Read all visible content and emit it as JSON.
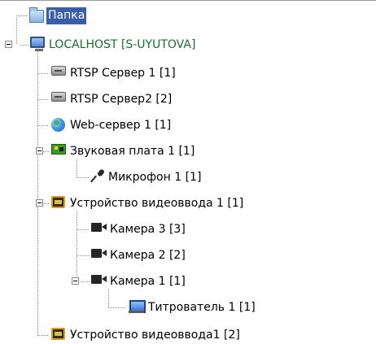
{
  "tree": {
    "folder": {
      "label": "Папка",
      "icon": "folder-icon"
    },
    "host": {
      "label": "LOCALHOST [S-UYUTOVA]",
      "icon": "monitor-icon",
      "color": "#16702a"
    },
    "rtsp1": {
      "label": "RTSP Сервер 1 [1]",
      "icon": "server-icon"
    },
    "rtsp2": {
      "label": "RTSP Сервер2 [2]",
      "icon": "server-icon"
    },
    "web": {
      "label": "Web-сервер 1 [1]",
      "icon": "globe-icon"
    },
    "sound": {
      "label": "Звуковая плата 1 [1]",
      "icon": "sound-card-icon"
    },
    "mic": {
      "label": "Микрофон 1 [1]",
      "icon": "microphone-icon"
    },
    "video1": {
      "label": "Устройство видеоввода 1 [1]",
      "icon": "chip-icon"
    },
    "cam3": {
      "label": "Камера 3 [3]",
      "icon": "camera-icon"
    },
    "cam2": {
      "label": "Камера 2 [2]",
      "icon": "camera-icon"
    },
    "cam1": {
      "label": "Камера 1 [1]",
      "icon": "camera-icon"
    },
    "titler": {
      "label": "Титрователь 1 [1]",
      "icon": "titler-icon"
    },
    "video2": {
      "label": "Устройство видеоввода1 [2]",
      "icon": "chip-icon"
    }
  },
  "colors": {
    "selection": "#3a5fa8",
    "host_text": "#16702a",
    "connector": "#8c8c8c"
  }
}
